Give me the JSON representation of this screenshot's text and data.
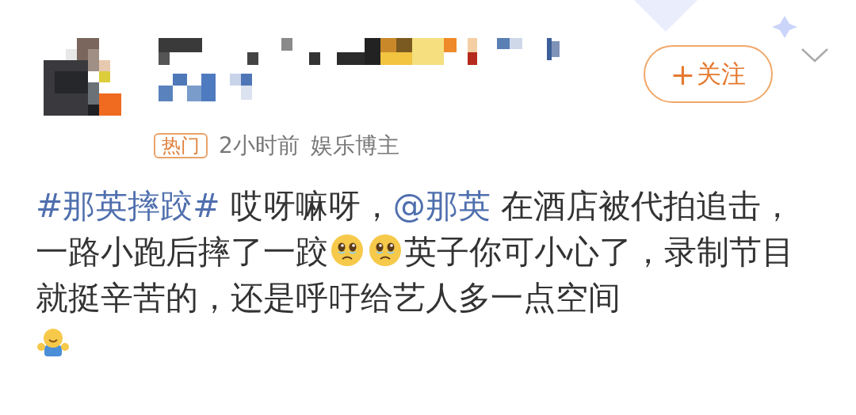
{
  "post": {
    "badge": "热门",
    "time": "2小时前",
    "author_type": "娱乐博主",
    "follow_button": {
      "icon": "+",
      "label": "关注"
    },
    "content": [
      {
        "kind": "topic",
        "text": "#那英摔跤#"
      },
      {
        "kind": "text",
        "text": " 哎呀嘛呀，"
      },
      {
        "kind": "mention",
        "text": "@那英"
      },
      {
        "kind": "text",
        "text": " 在酒店被代拍追击，一路小跑后摔了一跤"
      },
      {
        "kind": "sad"
      },
      {
        "kind": "sad"
      },
      {
        "kind": "text",
        "text": "英子你可小心了，录制节目就挺辛苦的，还是呼吁给艺人多一点空间"
      },
      {
        "kind": "hug"
      }
    ]
  }
}
